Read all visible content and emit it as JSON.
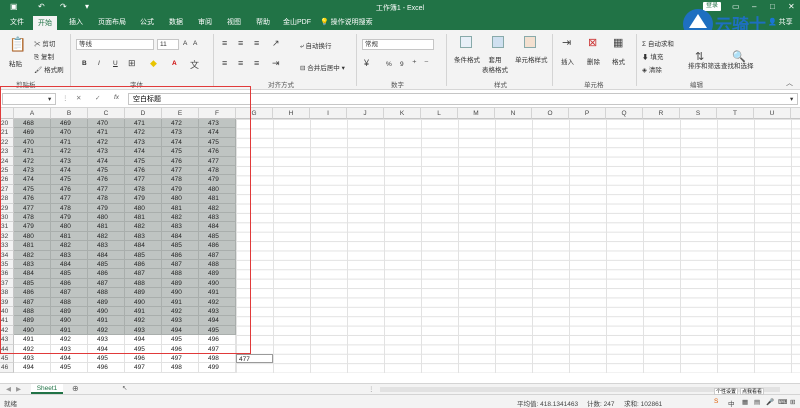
{
  "window": {
    "title": "工作簿1 - Excel",
    "login": "登录",
    "share": "共享"
  },
  "tabs": [
    "文件",
    "开始",
    "插入",
    "页面布局",
    "公式",
    "数据",
    "审阅",
    "视图",
    "帮助",
    "金山PDF",
    "操作说明搜索"
  ],
  "ribbon": {
    "clipboard": {
      "paste": "粘贴",
      "cut": "剪切",
      "copy": "复制",
      "format_painter": "格式刷",
      "group": "剪贴板"
    },
    "font": {
      "name_placeholder": "等线",
      "size": "11",
      "group": "字体",
      "bold": "B",
      "italic": "I",
      "underline": "U",
      "font_grow": "A",
      "font_shrink": "A",
      "font_color": "A"
    },
    "alignment": {
      "wrap": "自动换行",
      "merge": "合并后居中",
      "group": "对齐方式"
    },
    "number": {
      "format": "常规",
      "percent": "%",
      "comma": "9",
      "group": "数字"
    },
    "styles": {
      "conditional": "条件格式",
      "table": "套用\n表格格式",
      "cell_styles": "单元格样式",
      "group": "样式"
    },
    "cells": {
      "insert": "插入",
      "delete": "删除",
      "format": "格式",
      "group": "单元格"
    },
    "editing": {
      "autosum": "自动求和",
      "fill": "填充",
      "clear": "清除",
      "sort": "排序和筛选",
      "find": "查找和选择",
      "group": "编辑"
    }
  },
  "logo_text": "云骑士",
  "formula_bar": {
    "name_box": "",
    "cancel": "✕",
    "enter": "✓",
    "fx": "fx",
    "content": "空白标题"
  },
  "columns": [
    "A",
    "B",
    "C",
    "D",
    "E",
    "F",
    "G",
    "H",
    "I",
    "J",
    "K",
    "L",
    "M",
    "N",
    "O",
    "P",
    "Q",
    "R",
    "S",
    "T",
    "U",
    "V"
  ],
  "rows": [
    {
      "n": "20",
      "v": [
        "468",
        "469",
        "470",
        "471",
        "472",
        "473"
      ]
    },
    {
      "n": "21",
      "v": [
        "469",
        "470",
        "471",
        "472",
        "473",
        "474"
      ]
    },
    {
      "n": "22",
      "v": [
        "470",
        "471",
        "472",
        "473",
        "474",
        "475"
      ]
    },
    {
      "n": "23",
      "v": [
        "471",
        "472",
        "473",
        "474",
        "475",
        "476"
      ]
    },
    {
      "n": "24",
      "v": [
        "472",
        "473",
        "474",
        "475",
        "476",
        "477"
      ]
    },
    {
      "n": "25",
      "v": [
        "473",
        "474",
        "475",
        "476",
        "477",
        "478"
      ]
    },
    {
      "n": "26",
      "v": [
        "474",
        "475",
        "476",
        "477",
        "478",
        "479"
      ]
    },
    {
      "n": "27",
      "v": [
        "475",
        "476",
        "477",
        "478",
        "479",
        "480"
      ]
    },
    {
      "n": "28",
      "v": [
        "476",
        "477",
        "478",
        "479",
        "480",
        "481"
      ]
    },
    {
      "n": "29",
      "v": [
        "477",
        "478",
        "479",
        "480",
        "481",
        "482"
      ]
    },
    {
      "n": "30",
      "v": [
        "478",
        "479",
        "480",
        "481",
        "482",
        "483"
      ]
    },
    {
      "n": "31",
      "v": [
        "479",
        "480",
        "481",
        "482",
        "483",
        "484"
      ]
    },
    {
      "n": "32",
      "v": [
        "480",
        "481",
        "482",
        "483",
        "484",
        "485"
      ]
    },
    {
      "n": "33",
      "v": [
        "481",
        "482",
        "483",
        "484",
        "485",
        "486"
      ]
    },
    {
      "n": "34",
      "v": [
        "482",
        "483",
        "484",
        "485",
        "486",
        "487"
      ]
    },
    {
      "n": "35",
      "v": [
        "483",
        "484",
        "485",
        "486",
        "487",
        "488"
      ]
    },
    {
      "n": "36",
      "v": [
        "484",
        "485",
        "486",
        "487",
        "488",
        "489"
      ]
    },
    {
      "n": "37",
      "v": [
        "485",
        "486",
        "487",
        "488",
        "489",
        "490"
      ]
    },
    {
      "n": "38",
      "v": [
        "486",
        "487",
        "488",
        "489",
        "490",
        "491"
      ]
    },
    {
      "n": "39",
      "v": [
        "487",
        "488",
        "489",
        "490",
        "491",
        "492"
      ]
    },
    {
      "n": "40",
      "v": [
        "488",
        "489",
        "490",
        "491",
        "492",
        "493"
      ]
    },
    {
      "n": "41",
      "v": [
        "489",
        "490",
        "491",
        "492",
        "493",
        "494"
      ]
    },
    {
      "n": "42",
      "v": [
        "490",
        "491",
        "492",
        "493",
        "494",
        "495"
      ]
    },
    {
      "n": "43",
      "v": [
        "491",
        "492",
        "493",
        "494",
        "495",
        "496"
      ]
    },
    {
      "n": "44",
      "v": [
        "492",
        "493",
        "494",
        "495",
        "496",
        "497"
      ]
    },
    {
      "n": "45",
      "v": [
        "493",
        "494",
        "495",
        "496",
        "497",
        "498"
      ],
      "g": "477"
    },
    {
      "n": "46",
      "v": [
        "494",
        "495",
        "496",
        "497",
        "498",
        "499"
      ]
    }
  ],
  "selected_rows": 23,
  "sheets": {
    "active": "Sheet1",
    "add": "⊕"
  },
  "status": {
    "ready": "就绪",
    "average": "平均值: 418.1341463",
    "count": "计数: 247",
    "sum": "求和: 102861",
    "tooltip1": "个性设置",
    "tooltip2": "点我看看"
  },
  "colors": {
    "excel_green": "#217346",
    "selection": "#bfc4c2",
    "highlight_frame": "#e03a3a"
  }
}
